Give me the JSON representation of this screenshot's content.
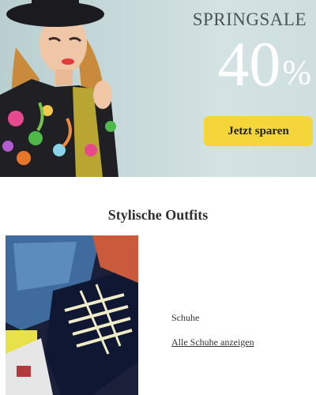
{
  "hero": {
    "title": "SPRINGSALE",
    "discount_number": "40",
    "discount_symbol": "%",
    "cta_label": "Jetzt sparen",
    "colors": {
      "background": "#c7d9da",
      "cta": "#f4d63a",
      "title": "#4b5456"
    }
  },
  "section": {
    "title": "Stylische Outfits",
    "product": {
      "label": "Schuhe",
      "link_text": "Alle Schuhe anzeigen"
    }
  }
}
